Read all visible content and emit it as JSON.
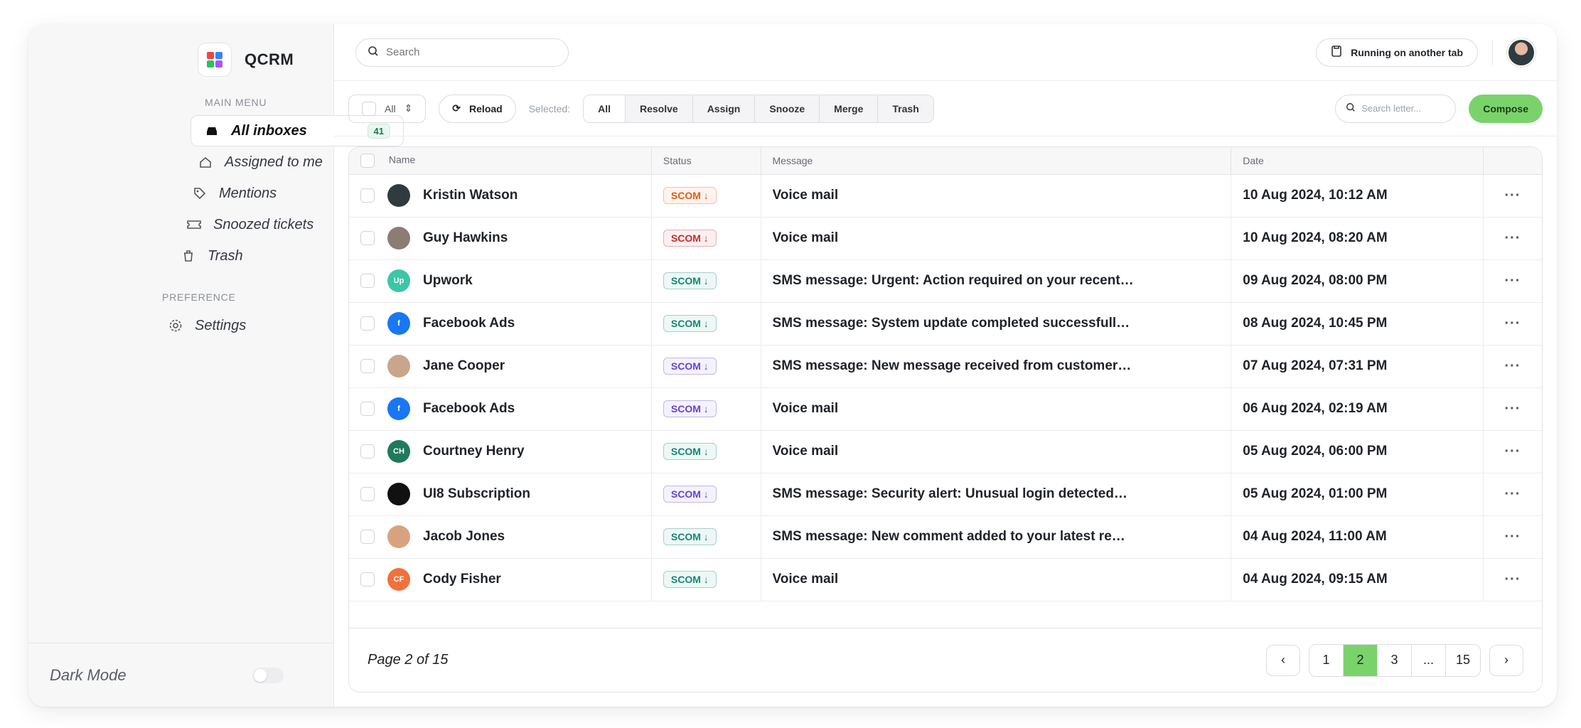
{
  "app": {
    "name": "QCRM"
  },
  "sidebar": {
    "main_menu_label": "MAIN MENU",
    "items": [
      {
        "label": "All inboxes",
        "badge": "41",
        "icon": "inbox-icon"
      },
      {
        "label": "Assigned to me",
        "icon": "home-icon"
      },
      {
        "label": "Mentions",
        "icon": "tag-icon"
      },
      {
        "label": "Snoozed tickets",
        "icon": "ticket-icon"
      },
      {
        "label": "Trash",
        "icon": "trash-icon"
      }
    ],
    "preference_label": "PREFERENCE",
    "settings_label": "Settings",
    "dark_mode_label": "Dark Mode"
  },
  "topbar": {
    "search_placeholder": "Search",
    "running_label": "Running on another tab"
  },
  "toolbar": {
    "filter_value": "All",
    "reload_label": "Reload",
    "selected_label": "Selected:",
    "actions": [
      "All",
      "Resolve",
      "Assign",
      "Snooze",
      "Merge",
      "Trash"
    ],
    "letter_search_placeholder": "Search letter...",
    "compose_label": "Compose"
  },
  "table": {
    "columns": [
      "Name",
      "Status",
      "Message",
      "Date"
    ],
    "rows": [
      {
        "name": "Kristin Watson",
        "status": "SCOM",
        "status_color": "#e8590c",
        "message": "Voice mail",
        "date": "10 Aug 2024, 10:12 AM",
        "avatar_color": "#2f3b3f",
        "initials": ""
      },
      {
        "name": "Guy Hawkins",
        "status": "SCOM",
        "status_color": "#c92a2a",
        "message": "Voice mail",
        "date": "10 Aug 2024, 08:20 AM",
        "avatar_color": "#8b7d74",
        "initials": ""
      },
      {
        "name": "Upwork",
        "status": "SCOM",
        "status_color": "#12877a",
        "message": "SMS message: Urgent: Action required on your recent…",
        "date": "09 Aug 2024, 08:00 PM",
        "avatar_color": "#3cc6a8",
        "initials": "Up"
      },
      {
        "name": "Facebook Ads",
        "status": "SCOM",
        "status_color": "#12877a",
        "message": "SMS message: System update completed successfull…",
        "date": "08 Aug 2024, 10:45 PM",
        "avatar_color": "#1877f2",
        "initials": "f"
      },
      {
        "name": "Jane Cooper",
        "status": "SCOM",
        "status_color": "#6741d9",
        "message": "SMS message: New message received from customer…",
        "date": "07 Aug 2024, 07:31 PM",
        "avatar_color": "#c9a58c",
        "initials": ""
      },
      {
        "name": "Facebook Ads",
        "status": "SCOM",
        "status_color": "#6741d9",
        "message": "Voice mail",
        "date": "06 Aug 2024, 02:19 AM",
        "avatar_color": "#1877f2",
        "initials": "f"
      },
      {
        "name": "Courtney Henry",
        "status": "SCOM",
        "status_color": "#12877a",
        "message": "Voice mail",
        "date": "05 Aug 2024, 06:00 PM",
        "avatar_color": "#1f7a5c",
        "initials": "CH"
      },
      {
        "name": "UI8 Subscription",
        "status": "SCOM",
        "status_color": "#6741d9",
        "message": "SMS message: Security alert: Unusual login detected…",
        "date": "05 Aug 2024, 01:00 PM",
        "avatar_color": "#111111",
        "initials": ""
      },
      {
        "name": "Jacob Jones",
        "status": "SCOM",
        "status_color": "#12877a",
        "message": "SMS message: New comment added to your latest re…",
        "date": "04 Aug 2024, 11:00 AM",
        "avatar_color": "#d9a27f",
        "initials": ""
      },
      {
        "name": "Cody Fisher",
        "status": "SCOM",
        "status_color": "#12877a",
        "message": "Voice mail",
        "date": "04 Aug 2024, 09:15 AM",
        "avatar_color": "#f0713c",
        "initials": "CF"
      }
    ]
  },
  "pagination": {
    "info": "Page 2 of 15",
    "pages": [
      "1",
      "2",
      "3",
      "...",
      "15"
    ],
    "current": "2",
    "prev": "‹",
    "next": "›"
  },
  "colors": {
    "accent": "#7ad36a"
  }
}
